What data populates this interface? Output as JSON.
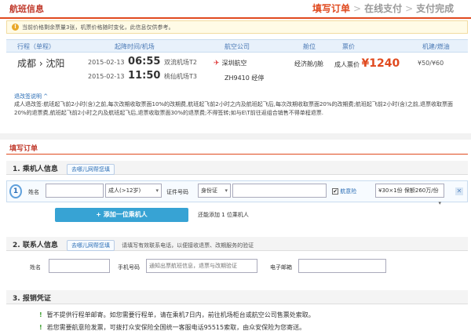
{
  "header": {
    "title": "航班信息",
    "steps": [
      {
        "label": "填写订单",
        "active": true
      },
      {
        "label": "在线支付",
        "active": false
      },
      {
        "label": "支付完成",
        "active": false
      }
    ],
    "step_arrow": ">"
  },
  "notice": {
    "icon": "warning-icon",
    "text": "当前价格剩余票量3张，机票价格随时变化，此信息仅供参考。"
  },
  "flight_table": {
    "columns": [
      "行程（单程）",
      "起降时间/机场",
      "航空公司",
      "舱位",
      "票价",
      "机建/燃油"
    ],
    "row": {
      "route": "成都 › 沈阳",
      "depart": {
        "date": "2015-02-13",
        "time": "06:55",
        "airport": "双流机场T2"
      },
      "arrive": {
        "date": "2015-02-13",
        "time": "11:50",
        "airport": "桃仙机场T3"
      },
      "airline": "深圳航空",
      "flight_no": "ZH9410",
      "stop": "经停",
      "airline_icon": "airline-logo-icon",
      "cabin": "经济舱/J舱",
      "price_label": "成人票价",
      "price": "¥1240",
      "tax": "¥50/¥60"
    }
  },
  "rules": {
    "link": "退改签说明 ^",
    "text": "成人退改签:航班起飞前2小时(含)之前,每次改期收取票面10%的改期费,航班起飞前2小时之内及航班起飞后,每次改期收取票面20%的改期费;航班起飞前2小时(含)之前,退票收取票面20%的退票费,航班起飞前2小时之内及航班起飞后,退票收取票面30%的退票费;不得签转;如与E\\T前往返组合销售不得单程退票."
  },
  "order": {
    "title": "填写订单",
    "passenger_section": {
      "title": "1. 乘机人信息",
      "help": "去哪儿网帮您填",
      "row_number": "1",
      "name_label": "姓名",
      "passenger_type": "成人(>12岁)",
      "id_label": "证件号码",
      "id_type": "身份证",
      "insurance_checked": true,
      "insurance_label": "航意险",
      "insurance_option": "¥30×1份 保额260万/份",
      "add_button": "+ 添加一位乘机人",
      "add_note": "还能添加 1 位乘机人"
    },
    "contact_section": {
      "title": "2. 联系人信息",
      "help": "去哪儿网帮您填",
      "note": "请填写有效联系电话，以便接收退票、改期服务的验证",
      "name_label": "姓名",
      "phone_label": "手机号码",
      "phone_placeholder": "通知出票航班信息，退票与改期验证",
      "email_label": "电子邮箱"
    },
    "voucher_section": {
      "title": "3. 报销凭证",
      "items": [
        "暂不提供行程单邮寄。如您需要行程单，请在乘机7日内，前往机场柜台或航空公司售票处索取。",
        "若您需要航意险发票，可拨打众安保险全国统一客服电话95515索取，由众安保险为您寄送。"
      ]
    }
  },
  "colors": {
    "accent": "#e04a1f",
    "link": "#2a6db5",
    "add_button": "#37a3d4",
    "table_header": "#e8f1fb"
  }
}
